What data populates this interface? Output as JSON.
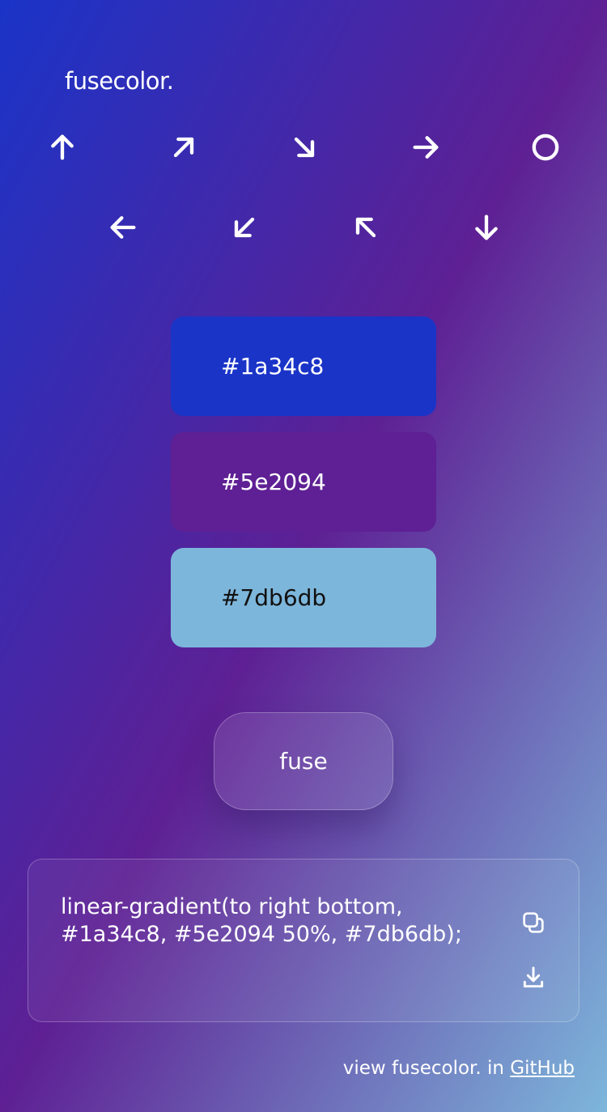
{
  "app": {
    "logo": "fusecolor."
  },
  "directions": [
    {
      "name": "up",
      "icon": "arrow-up-icon"
    },
    {
      "name": "up-right",
      "icon": "arrow-up-right-icon"
    },
    {
      "name": "down-right",
      "icon": "arrow-down-right-icon"
    },
    {
      "name": "right",
      "icon": "arrow-right-icon"
    },
    {
      "name": "radial",
      "icon": "circle-icon"
    },
    {
      "name": "left",
      "icon": "arrow-left-icon"
    },
    {
      "name": "down-left",
      "icon": "arrow-down-left-icon"
    },
    {
      "name": "up-left",
      "icon": "arrow-up-left-icon"
    },
    {
      "name": "down",
      "icon": "arrow-down-icon"
    }
  ],
  "swatches": [
    {
      "hex": "#1a34c8",
      "text_color": "#ffffff"
    },
    {
      "hex": "#5e2094",
      "text_color": "#ffffff"
    },
    {
      "hex": "#7db6db",
      "text_color": "#111111"
    }
  ],
  "fuse_label": "fuse",
  "output": {
    "code_line1": "linear-gradient(to right bottom,",
    "code_line2": "#1a34c8, #5e2094 50%, #7db6db);",
    "copy_icon": "copy-icon",
    "download_icon": "download-icon"
  },
  "footer": {
    "text": "view fusecolor. in",
    "link_label": "GitHub"
  },
  "colors": {
    "gradient_start": "#1a34c8",
    "gradient_mid": "#5e2094",
    "gradient_end": "#7db6db",
    "text": "#ffffff"
  }
}
